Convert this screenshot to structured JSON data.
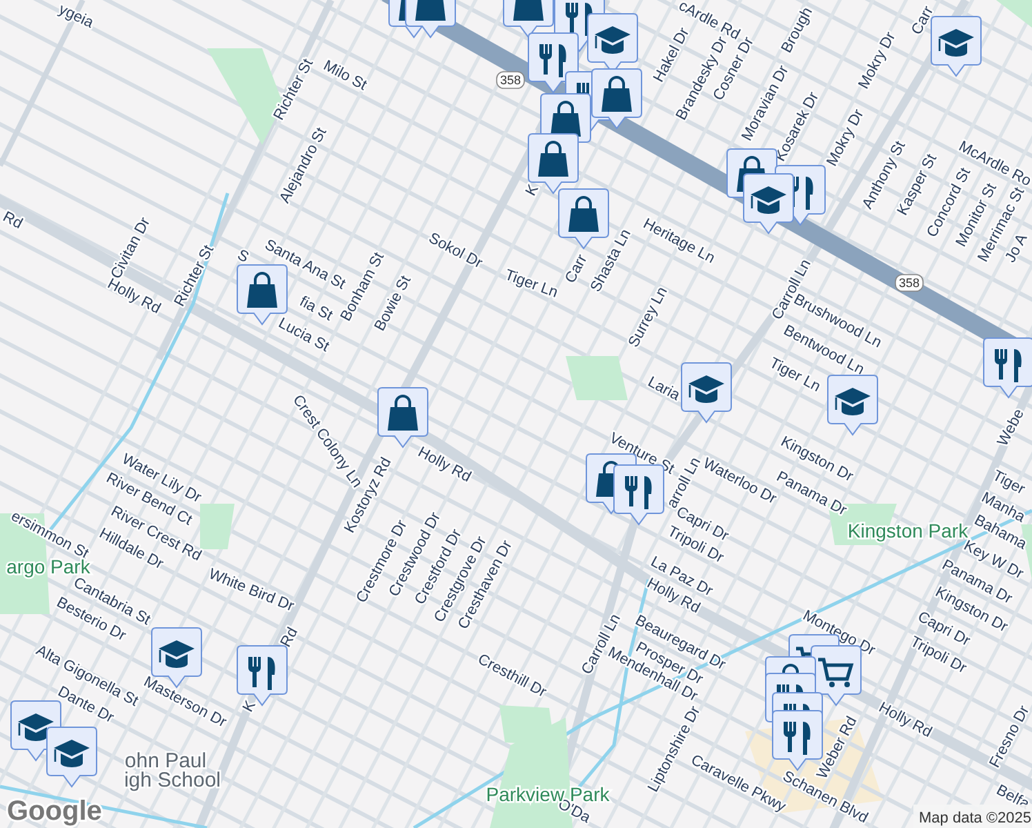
{
  "street_labels": [
    "ygeia",
    "Rd",
    "Milo St",
    "Richter St",
    "Alejandro St",
    "Civitan Dr",
    "Richter St",
    "Holly Rd",
    "Santa Ana St",
    "S",
    "fia St",
    "Lucia St",
    "Bonham St",
    "Bowie St",
    "Sokol Dr",
    "Tiger Ln",
    "K",
    "cArdle Rd",
    "Hakel Dr",
    "Brandesky Dr",
    "Cosner Dr",
    "Brough",
    "Moravian Dr",
    "Kosarek Dr",
    "Mokry Dr",
    "Mokry Dr",
    "Carr",
    "McArdle Ro",
    "Anthony St",
    "Kasper St",
    "Concord St",
    "Monitor St",
    "Merrimac St",
    "Jo A",
    "Heritage Ln",
    "Carr",
    "Shasta Ln",
    "Surrey Ln",
    "Carroll Ln",
    "Brushwood Ln",
    "Bentwood Ln",
    "Tiger Ln",
    "Laria",
    "Crest Colony Ln",
    "Kostoryz Rd",
    "Holly Rd",
    "Water Lily Dr",
    "River Bend Ct",
    "ersimmon St",
    "River Crest Rd",
    "Hilldale Dr",
    "Cantabria St",
    "Besterio Dr",
    "White Bird Dr",
    "Crestmore Dr",
    "Crestwood Dr",
    "Crestford Dr",
    "Crestgrove Dr",
    "Cresthaven Dr",
    "Cresthill Dr",
    "Alta Gigonella St",
    "Masterson Dr",
    "Dante Dr",
    "Rd",
    "K",
    "Venture St",
    "arroll Ln",
    "Waterloo Dr",
    "Kingston Dr",
    "Panama Dr",
    "Capri Dr",
    "Tripoli Dr",
    "La Paz Dr",
    "Holly Rd",
    "Beauregard Dr",
    "Carroll Ln",
    "Prosper Dr",
    "Mendenhall Dr",
    "Liptonshire Dr",
    "Caravelle Pkwy",
    "Schanen Blvd",
    "Weber Rd",
    "Holly Rd",
    "Montego Dr",
    "Tripoli Dr",
    "Capri Dr",
    "Kingston Dr",
    "Panama Dr",
    "Key W Dr",
    "Bahama",
    "Manha",
    "Tiger",
    "Webe",
    "Fresno Dr",
    "Belfa",
    "O'Da"
  ],
  "park_labels": [
    "argo Park",
    "Kingston Park",
    "Parkview Park"
  ],
  "place_labels": [
    "ohn Paul",
    "igh School"
  ],
  "route_shields": [
    "358",
    "358"
  ],
  "markers": [
    {
      "kind": "shop"
    },
    {
      "kind": "shop"
    },
    {
      "kind": "shop"
    },
    {
      "kind": "restaurant"
    },
    {
      "kind": "school"
    },
    {
      "kind": "restaurant"
    },
    {
      "kind": "restaurant"
    },
    {
      "kind": "shop"
    },
    {
      "kind": "shop"
    },
    {
      "kind": "shop"
    },
    {
      "kind": "shop"
    },
    {
      "kind": "school"
    },
    {
      "kind": "shop"
    },
    {
      "kind": "restaurant"
    },
    {
      "kind": "school"
    },
    {
      "kind": "shop"
    },
    {
      "kind": "school"
    },
    {
      "kind": "school"
    },
    {
      "kind": "restaurant"
    },
    {
      "kind": "shop"
    },
    {
      "kind": "shop"
    },
    {
      "kind": "restaurant"
    },
    {
      "kind": "school"
    },
    {
      "kind": "restaurant"
    },
    {
      "kind": "grocery"
    },
    {
      "kind": "grocery"
    },
    {
      "kind": "shop"
    },
    {
      "kind": "restaurant"
    },
    {
      "kind": "restaurant"
    },
    {
      "kind": "restaurant"
    },
    {
      "kind": "school"
    },
    {
      "kind": "school"
    }
  ],
  "logo": "Google",
  "attribution": "Map data ©2025"
}
